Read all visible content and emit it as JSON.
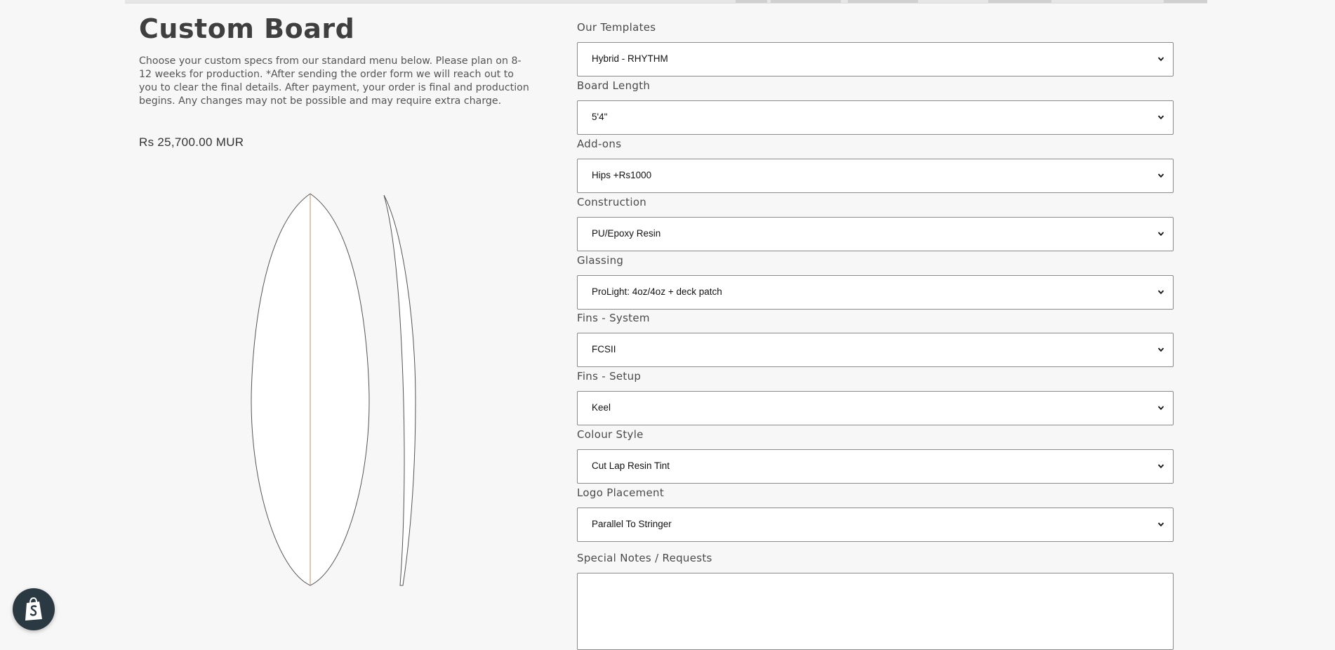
{
  "product": {
    "title": "Custom Board",
    "description": "Choose your custom specs from our standard menu below. Please plan on 8-12 weeks for production. *After sending the order form we will reach out to you to clear the final details. After payment, your order is final and production begins. Any changes may not be possible and may require extra charge.",
    "price": "Rs 25,700.00 MUR"
  },
  "form": {
    "fields": [
      {
        "label": "Our Templates",
        "value": "Hybrid - RHYTHM"
      },
      {
        "label": "Board Length",
        "value": "5'4\""
      },
      {
        "label": "Add-ons",
        "value": "Hips +Rs1000"
      },
      {
        "label": "Construction",
        "value": "PU/Epoxy Resin"
      },
      {
        "label": "Glassing",
        "value": "ProLight: 4oz/4oz + deck patch"
      },
      {
        "label": "Fins - System",
        "value": "FCSII"
      },
      {
        "label": "Fins - Setup",
        "value": "Keel"
      },
      {
        "label": "Colour Style",
        "value": "Cut Lap Resin Tint"
      },
      {
        "label": "Logo Placement",
        "value": "Parallel To Stringer"
      }
    ],
    "notes": {
      "label": "Special Notes / Requests",
      "value": ""
    }
  },
  "icons": {
    "dropdown": "chevron-down-icon",
    "shopify": "shopify-bag-icon"
  },
  "colors": {
    "background": "#f7f7f7",
    "text": "#4a4a4a",
    "stringer": "#b8926a",
    "shopify_badge": "#2b3a42"
  }
}
